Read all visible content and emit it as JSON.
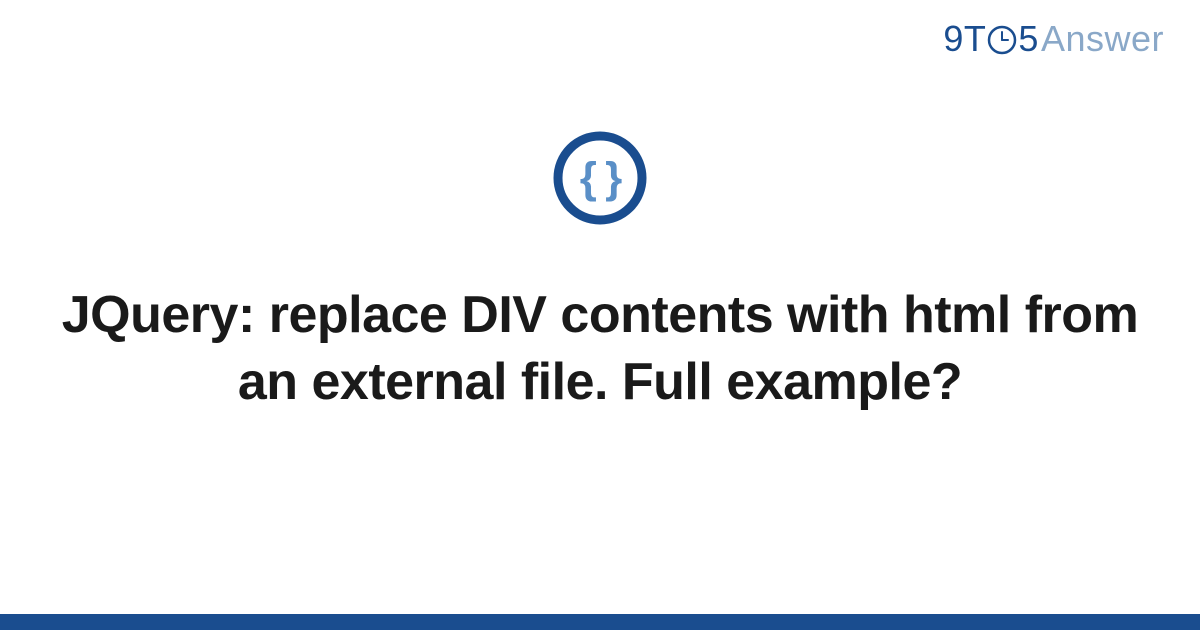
{
  "logo": {
    "prefix_9t": "9T",
    "five": "5",
    "suffix": "Answer"
  },
  "icon": {
    "name": "code-braces-icon"
  },
  "title": "JQuery: replace DIV contents with html from an external file. Full example?",
  "colors": {
    "brand_dark": "#1a4d8f",
    "brand_light": "#5a8fc7",
    "logo_muted": "#8aa8c8"
  }
}
